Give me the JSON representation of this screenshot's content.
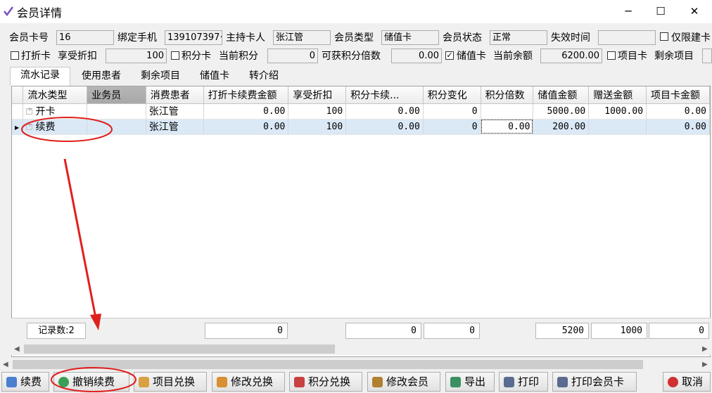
{
  "window": {
    "title": "会员详情",
    "min": "─",
    "max": "☐",
    "close": "✕"
  },
  "info": {
    "card_no_label": "会员卡号",
    "card_no": "16",
    "phone_label": "绑定手机",
    "phone": "139107397·",
    "holder_label": "主持卡人",
    "holder": "张江管",
    "type_label": "会员类型",
    "type": "储值卡",
    "status_label": "会员状态",
    "status": "正常",
    "expire_label": "失效时间",
    "expire": "",
    "only_build_label": "仅限建卡",
    "discount_card_label": "打折卡",
    "discount_label": "享受折扣",
    "discount": "100",
    "points_card_label": "积分卡",
    "points_label": "当前积分",
    "points": "0",
    "multiplier_label": "可获积分倍数",
    "multiplier": "0.00",
    "stored_card_label": "储值卡",
    "balance_label": "当前余额",
    "balance": "6200.00",
    "project_card_label": "项目卡",
    "remaining_label": "剩余项目"
  },
  "tabs": [
    "流水记录",
    "使用患者",
    "剩余项目",
    "储值卡",
    "转介绍"
  ],
  "columns": [
    "流水类型",
    "业务员",
    "消费患者",
    "打折卡续费金额",
    "享受折扣",
    "积分卡续...",
    "积分变化",
    "积分倍数",
    "储值金额",
    "赠送金额",
    "项目卡金额"
  ],
  "rows": [
    [
      "开卡",
      "",
      "张江管",
      "0.00",
      "100",
      "0.00",
      "0",
      "",
      "5000.00",
      "1000.00",
      "0.00"
    ],
    [
      "续费",
      "",
      "张江管",
      "0.00",
      "100",
      "0.00",
      "0",
      "0.00",
      "200.00",
      "",
      "0.00"
    ]
  ],
  "footer": {
    "record_count": "记录数:2",
    "discount_total": "0",
    "points_card_total": "0",
    "points_change_total": "0",
    "stored_total": "5200",
    "gift_total": "1000",
    "project_total": "0"
  },
  "buttons": [
    "续费",
    "撤销续费",
    "项目兑换",
    "修改兑换",
    "积分兑换",
    "修改会员",
    "导出",
    "打印",
    "打印会员卡",
    "取消"
  ],
  "colors": {
    "annotation": "#e0201c",
    "selected_row": "#dbe9f7"
  },
  "icons": [
    "app-check-icon",
    "renew-icon",
    "undo-renew-icon",
    "project-exchange-icon",
    "modify-exchange-icon",
    "points-exchange-icon",
    "edit-member-icon",
    "export-icon",
    "print-icon",
    "print-card-icon",
    "cancel-icon"
  ]
}
